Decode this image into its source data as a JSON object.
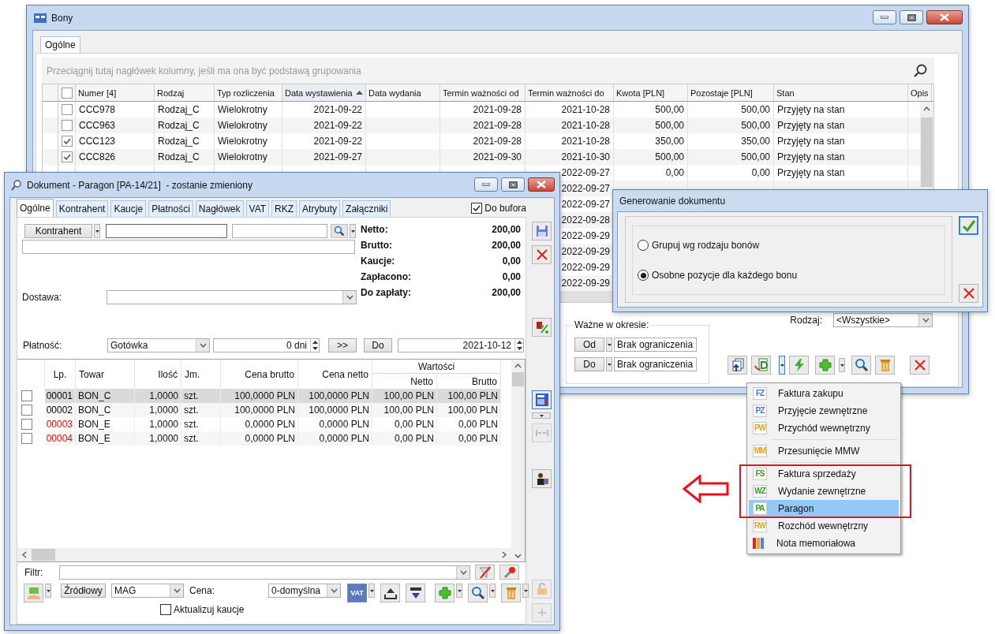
{
  "bony": {
    "title": "Bony",
    "tabs": [
      {
        "label": "Ogólne",
        "selected": true
      }
    ],
    "group_hint": "Przeciągnij tutaj nagłówek kolumny, jeśli ma ona być podstawą grupowania",
    "header_checked": false,
    "columns": [
      {
        "label": "Numer [4]",
        "sorted": false
      },
      {
        "label": "Rodzaj",
        "sorted": false
      },
      {
        "label": "Typ rozliczenia",
        "sorted": false
      },
      {
        "label": "Data wystawienia",
        "sorted": true
      },
      {
        "label": "Data wydania",
        "sorted": false
      },
      {
        "label": "Termin ważności od",
        "sorted": false
      },
      {
        "label": "Termin ważności do",
        "sorted": false
      },
      {
        "label": "Kwota [PLN]",
        "sorted": false
      },
      {
        "label": "Pozostaje [PLN]",
        "sorted": false
      },
      {
        "label": "Stan",
        "sorted": false
      },
      {
        "label": "Opis",
        "sorted": false
      }
    ],
    "rows": [
      {
        "checked": false,
        "cells": [
          "CCC978",
          "Rodzaj_C",
          "Wielokrotny",
          "2021-09-22",
          null,
          "2021-09-28",
          "2021-10-28",
          "500,00",
          "500,00",
          "Przyjęty na stan",
          null
        ]
      },
      {
        "checked": false,
        "cells": [
          "CCC963",
          "Rodzaj_C",
          "Wielokrotny",
          "2021-09-22",
          null,
          "2021-09-28",
          "2021-10-28",
          "500,00",
          "500,00",
          "Przyjęty na stan",
          null
        ]
      },
      {
        "checked": true,
        "cells": [
          "CCC123",
          "Rodzaj_C",
          "Wielokrotny",
          "2021-09-22",
          null,
          "2021-09-28",
          "2021-10-28",
          "350,00",
          "350,00",
          "Przyjęty na stan",
          null
        ]
      },
      {
        "checked": true,
        "cells": [
          "CCC826",
          "Rodzaj_C",
          "Wielokrotny",
          "2021-09-27",
          null,
          "2021-09-30",
          "2021-10-30",
          "500,00",
          "500,00",
          "Przyjęty na stan",
          null
        ]
      },
      {
        "cells": [
          null,
          null,
          null,
          null,
          null,
          null,
          "2022-09-27",
          "0,00",
          "0,00",
          "Przyjęty na stan",
          null
        ]
      },
      {
        "cells": [
          null,
          null,
          null,
          null,
          null,
          null,
          "2022-09-27",
          null,
          null,
          null,
          null
        ]
      },
      {
        "cells": [
          null,
          null,
          null,
          null,
          null,
          null,
          "2022-09-27",
          null,
          null,
          null,
          null
        ]
      },
      {
        "cells": [
          null,
          null,
          null,
          null,
          null,
          null,
          "2022-09-28",
          null,
          null,
          null,
          null
        ]
      },
      {
        "cells": [
          null,
          null,
          null,
          null,
          null,
          null,
          "2022-09-29",
          null,
          null,
          null,
          null
        ]
      },
      {
        "cells": [
          null,
          null,
          null,
          null,
          null,
          null,
          "2022-09-29",
          null,
          null,
          null,
          null
        ]
      },
      {
        "cells": [
          null,
          null,
          null,
          null,
          null,
          null,
          "2022-09-29",
          null,
          null,
          null,
          null
        ]
      },
      {
        "cells": [
          null,
          null,
          null,
          null,
          null,
          null,
          "2022-09-29",
          null,
          null,
          null,
          null
        ]
      }
    ],
    "period": {
      "title": "Ważne w okresie:",
      "from_button": "Od",
      "from_value": "Brak ograniczenia",
      "to_button": "Do",
      "to_value": "Brak ograniczenia"
    },
    "rodzaj": {
      "label": "Rodzaj:",
      "value": "<Wszystkie>"
    }
  },
  "generowanie": {
    "title": "Generowanie dokumentu",
    "options": [
      {
        "label": "Grupuj wg rodzaju bonów",
        "selected": false
      },
      {
        "label": "Osobne pozycje dla każdego bonu",
        "selected": true
      }
    ]
  },
  "menu": {
    "groups": [
      [
        {
          "code": "FZ",
          "color": "#3b7ddd",
          "label": "Faktura zakupu",
          "selected": false
        },
        {
          "code": "PZ",
          "color": "#3b7ddd",
          "label": "Przyjęcie zewnętrzne",
          "selected": false
        },
        {
          "code": "PW",
          "color": "#e8a21c",
          "label": "Przychód wewnętrzny",
          "selected": false
        }
      ],
      [
        {
          "code": "MM",
          "color": "#e8a21c",
          "label": "Przesunięcie MMW",
          "selected": false
        }
      ],
      [
        {
          "code": "FS",
          "color": "#3f9a1e",
          "label": "Faktura sprzedaży",
          "selected": false
        },
        {
          "code": "WZ",
          "color": "#3f9a1e",
          "label": "Wydanie zewnętrzne",
          "selected": false
        },
        {
          "code": "PA",
          "color": "#3f9a1e",
          "label": "Paragon",
          "selected": true
        },
        {
          "code": "RW",
          "color": "#e8a21c",
          "label": "Rozchód wewnętrzny",
          "selected": false
        },
        {
          "label": "Nota memoriałowa",
          "selected": false
        }
      ]
    ]
  },
  "dokument": {
    "title": "Dokument - Paragon [PA-14/21]  - zostanie zmieniony",
    "tabs": [
      {
        "label": "Ogólne",
        "selected": true
      },
      {
        "label": "Kontrahent",
        "selected": false
      },
      {
        "label": "Kaucje",
        "selected": false
      },
      {
        "label": "Płatności",
        "selected": false
      },
      {
        "label": "Nagłówek",
        "selected": false
      },
      {
        "label": "VAT",
        "selected": false
      },
      {
        "label": "RKZ",
        "selected": false
      },
      {
        "label": "Atrybuty",
        "selected": false
      },
      {
        "label": "Załączniki",
        "selected": false
      }
    ],
    "do_bufora": {
      "label": "Do bufora",
      "checked": true
    },
    "kontrahent_button": "Kontrahent",
    "totals": [
      {
        "label": "Netto:",
        "value": "200,00"
      },
      {
        "label": "Brutto:",
        "value": "200,00"
      },
      {
        "label": "Kaucje:",
        "value": "0,00"
      },
      {
        "label": "Zapłacono:",
        "value": "0,00"
      },
      {
        "label": "Do zapłaty:",
        "value": "200,00"
      }
    ],
    "dostawa_label": "Dostawa:",
    "platnosc": {
      "label": "Płatność:",
      "method": "Gotówka",
      "term": "0 dni",
      "shift_button": ">>",
      "do_button": "Do",
      "date": "2021-10-12"
    },
    "items": {
      "columns": [
        "Lp.",
        "Towar",
        "Ilość",
        "Jm.",
        "Cena brutto",
        "Cena netto"
      ],
      "group": {
        "label": "Wartości",
        "columns": [
          "Netto",
          "Brutto"
        ]
      },
      "rows": [
        {
          "checked": false,
          "selected": true,
          "color": "#000000",
          "cells": [
            "00001",
            "BON_C",
            "1,0000",
            "szt.",
            "100,0000 PLN",
            "100,0000 PLN",
            "100,00 PLN",
            "100,00 PLN"
          ]
        },
        {
          "checked": false,
          "selected": false,
          "color": "#000000",
          "cells": [
            "00002",
            "BON_C",
            "1,0000",
            "szt.",
            "100,0000 PLN",
            "100,0000 PLN",
            "100,00 PLN",
            "100,00 PLN"
          ]
        },
        {
          "checked": false,
          "selected": false,
          "color": "#ff0000",
          "cells": [
            "00003",
            "BON_E",
            "1,0000",
            "szt.",
            "0,0000 PLN",
            "0,0000 PLN",
            "0,00 PLN",
            "0,00 PLN"
          ]
        },
        {
          "checked": false,
          "selected": false,
          "color": "#ff0000",
          "cells": [
            "00004",
            "BON_E",
            "1,0000",
            "szt.",
            "0,0000 PLN",
            "0,0000 PLN",
            "0,00 PLN",
            "0,00 PLN"
          ]
        }
      ]
    },
    "filter_label": "Filtr:",
    "source_button": "Źródłowy",
    "warehouse": "MAG",
    "price_label": "Cena:",
    "price_value": "0-domyślna",
    "vat_button": "VAT",
    "update_deposits": {
      "label": "Aktualizuj kaucje",
      "checked": false
    }
  }
}
